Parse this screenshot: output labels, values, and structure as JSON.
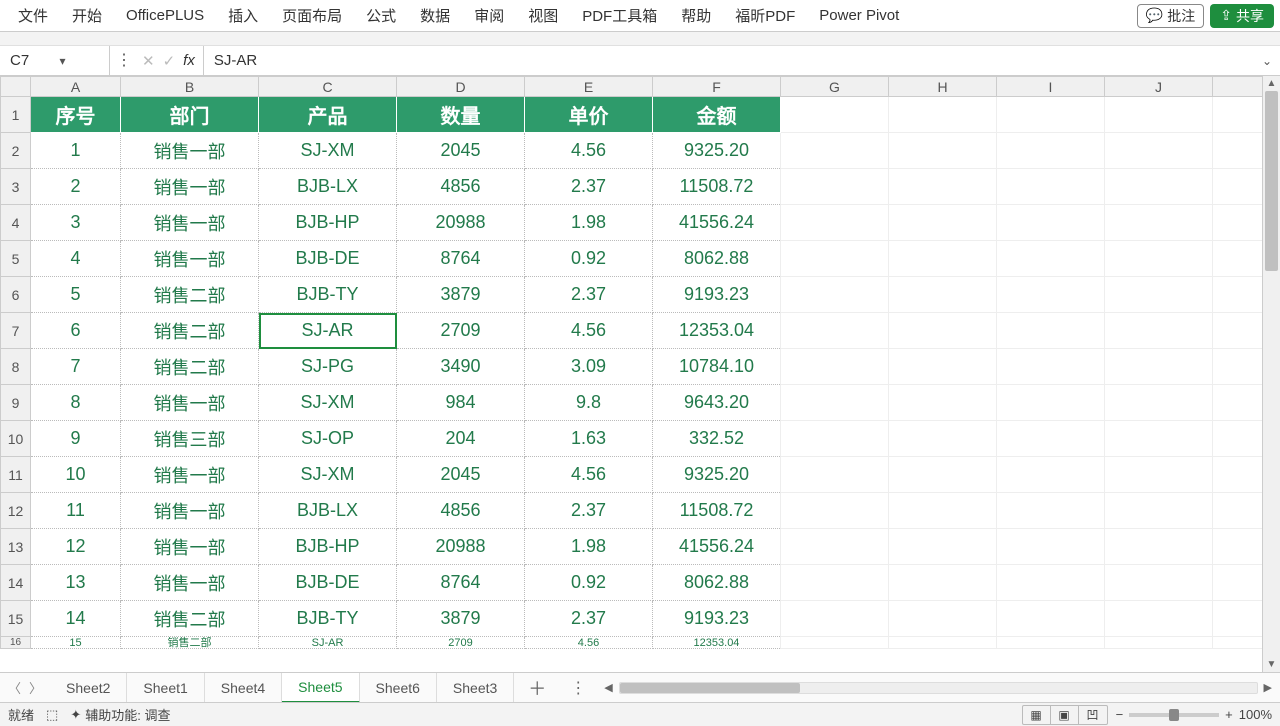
{
  "ribbon": {
    "items": [
      "文件",
      "开始",
      "OfficePLUS",
      "插入",
      "页面布局",
      "公式",
      "数据",
      "审阅",
      "视图",
      "PDF工具箱",
      "帮助",
      "福昕PDF",
      "Power Pivot"
    ],
    "comment_label": "批注",
    "share_label": "共享"
  },
  "name_box": "C7",
  "formula": "SJ-AR",
  "columns": [
    "A",
    "B",
    "C",
    "D",
    "E",
    "F",
    "G",
    "H",
    "I",
    "J"
  ],
  "headers": [
    "序号",
    "部门",
    "产品",
    "数量",
    "单价",
    "金额"
  ],
  "rows": [
    {
      "n": 1,
      "v": [
        "1",
        "销售一部",
        "SJ-XM",
        "2045",
        "4.56",
        "9325.20"
      ]
    },
    {
      "n": 2,
      "v": [
        "2",
        "销售一部",
        "BJB-LX",
        "4856",
        "2.37",
        "11508.72"
      ]
    },
    {
      "n": 3,
      "v": [
        "3",
        "销售一部",
        "BJB-HP",
        "20988",
        "1.98",
        "41556.24"
      ]
    },
    {
      "n": 4,
      "v": [
        "4",
        "销售一部",
        "BJB-DE",
        "8764",
        "0.92",
        "8062.88"
      ]
    },
    {
      "n": 5,
      "v": [
        "5",
        "销售二部",
        "BJB-TY",
        "3879",
        "2.37",
        "9193.23"
      ]
    },
    {
      "n": 6,
      "v": [
        "6",
        "销售二部",
        "SJ-AR",
        "2709",
        "4.56",
        "12353.04"
      ]
    },
    {
      "n": 7,
      "v": [
        "7",
        "销售二部",
        "SJ-PG",
        "3490",
        "3.09",
        "10784.10"
      ]
    },
    {
      "n": 8,
      "v": [
        "8",
        "销售一部",
        "SJ-XM",
        "984",
        "9.8",
        "9643.20"
      ]
    },
    {
      "n": 9,
      "v": [
        "9",
        "销售三部",
        "SJ-OP",
        "204",
        "1.63",
        "332.52"
      ]
    },
    {
      "n": 10,
      "v": [
        "10",
        "销售一部",
        "SJ-XM",
        "2045",
        "4.56",
        "9325.20"
      ]
    },
    {
      "n": 11,
      "v": [
        "11",
        "销售一部",
        "BJB-LX",
        "4856",
        "2.37",
        "11508.72"
      ]
    },
    {
      "n": 12,
      "v": [
        "12",
        "销售一部",
        "BJB-HP",
        "20988",
        "1.98",
        "41556.24"
      ]
    },
    {
      "n": 13,
      "v": [
        "13",
        "销售一部",
        "BJB-DE",
        "8764",
        "0.92",
        "8062.88"
      ]
    },
    {
      "n": 14,
      "v": [
        "14",
        "销售二部",
        "BJB-TY",
        "3879",
        "2.37",
        "9193.23"
      ]
    }
  ],
  "partial_row": {
    "n": 15,
    "v": [
      "15",
      "销售二部",
      "SJ-AR",
      "2709",
      "4.56",
      "12353.04"
    ]
  },
  "selected_cell": "C7",
  "sheet_tabs": [
    "Sheet2",
    "Sheet1",
    "Sheet4",
    "Sheet5",
    "Sheet6",
    "Sheet3"
  ],
  "active_tab": "Sheet5",
  "status": {
    "ready": "就绪",
    "accessibility": "辅助功能: 调查",
    "zoom": "100%"
  }
}
